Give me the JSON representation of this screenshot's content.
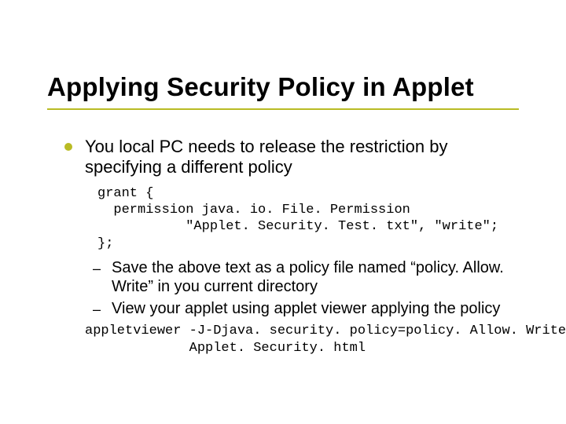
{
  "title": "Applying Security Policy in Applet",
  "bullet": {
    "text": "You local PC needs to release the restriction by specifying a different policy"
  },
  "code1": "grant {\n  permission java. io. File. Permission\n           \"Applet. Security. Test. txt\", \"write\";\n};",
  "sub": [
    "Save the above text as a policy file named “policy. Allow. Write” in you current directory",
    "View your applet using applet viewer applying the policy"
  ],
  "code2": "appletviewer -J-Djava. security. policy=policy. Allow. Write\n             Applet. Security. html"
}
